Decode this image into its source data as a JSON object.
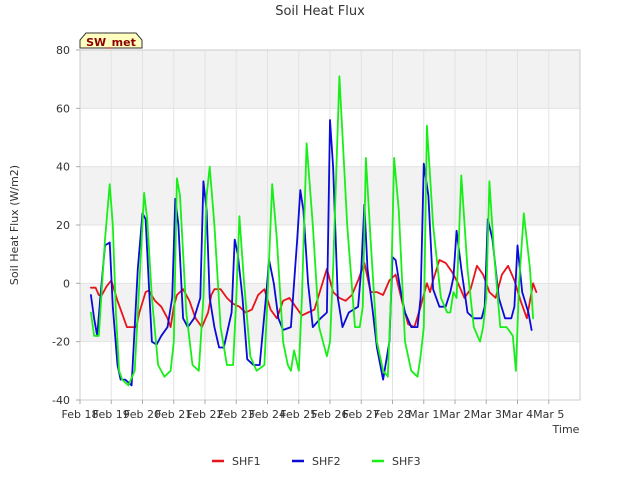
{
  "chart_data": {
    "type": "line",
    "title": "Soil Heat Flux",
    "xlabel": "Time",
    "ylabel": "Soil Heat Flux (W/m2)",
    "annotation": "SW_met",
    "ylim": [
      -40,
      80
    ],
    "yticks": [
      -40,
      -20,
      0,
      20,
      40,
      60,
      80
    ],
    "xlim": [
      0,
      16
    ],
    "xtick_labels": [
      "Feb 18",
      "Feb 19",
      "Feb 20",
      "Feb 21",
      "Feb 22",
      "Feb 23",
      "Feb 24",
      "Feb 25",
      "Feb 26",
      "Feb 27",
      "Feb 28",
      "Mar 1",
      "Mar 2",
      "Mar 3",
      "Mar 4",
      "Mar 5"
    ],
    "grid": true,
    "shaded_bands": [
      [
        -20,
        0
      ],
      [
        20,
        40
      ],
      [
        60,
        80
      ]
    ],
    "legend_position": "bottom-center",
    "series": [
      {
        "name": "SHF1",
        "color": "#e8141c",
        "x": [
          0.35,
          0.5,
          0.6,
          0.7,
          0.85,
          1.0,
          1.2,
          1.4,
          1.5,
          1.8,
          1.9,
          2.1,
          2.2,
          2.4,
          2.6,
          2.8,
          2.9,
          3.0,
          3.1,
          3.3,
          3.5,
          3.7,
          3.9,
          4.1,
          4.2,
          4.3,
          4.5,
          4.7,
          4.9,
          5.1,
          5.3,
          5.5,
          5.7,
          5.9,
          6.1,
          6.3,
          6.5,
          6.7,
          6.9,
          7.1,
          7.3,
          7.5,
          7.7,
          7.9,
          8.1,
          8.3,
          8.5,
          8.7,
          8.9,
          9.1,
          9.3,
          9.5,
          9.7,
          9.9,
          10.1,
          10.3,
          10.5,
          10.7,
          10.9,
          11.1,
          11.2,
          11.3,
          11.5,
          11.7,
          11.9,
          12.1,
          12.3,
          12.5,
          12.7,
          12.9,
          13.1,
          13.3,
          13.5,
          13.7,
          13.9,
          14.1,
          14.3,
          14.5,
          14.6
        ],
        "y": [
          -1.5,
          -1.5,
          -4,
          -4,
          -1,
          1,
          -6,
          -12,
          -15,
          -15,
          -10,
          -3,
          -2.5,
          -6,
          -8,
          -12,
          -15,
          -8,
          -4,
          -2,
          -6,
          -12,
          -15,
          -10,
          -4,
          -2,
          -2,
          -5,
          -7,
          -8,
          -10,
          -9,
          -4,
          -2,
          -9,
          -12,
          -6,
          -5,
          -8,
          -11,
          -10,
          -9,
          -2,
          5,
          -3,
          -5,
          -6,
          -4,
          1,
          7,
          -3,
          -3,
          -4,
          1,
          3,
          -6,
          -14,
          -15,
          -8,
          0,
          -3,
          1,
          8,
          7,
          4,
          0,
          -5,
          -2,
          6,
          3,
          -3,
          -5,
          3,
          6,
          1,
          -6,
          -12,
          0,
          -3
        ]
      },
      {
        "name": "SHF2",
        "color": "#0a0ad9",
        "x": [
          0.35,
          0.45,
          0.55,
          0.65,
          0.8,
          0.95,
          1.05,
          1.2,
          1.3,
          1.45,
          1.65,
          1.85,
          2.0,
          2.1,
          2.2,
          2.3,
          2.45,
          2.6,
          2.8,
          2.95,
          3.05,
          3.15,
          3.3,
          3.45,
          3.65,
          3.85,
          3.95,
          4.05,
          4.15,
          4.3,
          4.45,
          4.6,
          4.85,
          4.95,
          5.05,
          5.2,
          5.35,
          5.55,
          5.75,
          5.95,
          6.05,
          6.2,
          6.35,
          6.5,
          6.75,
          6.95,
          7.05,
          7.15,
          7.3,
          7.45,
          7.7,
          7.9,
          8.0,
          8.1,
          8.25,
          8.4,
          8.6,
          8.9,
          9.0,
          9.1,
          9.2,
          9.35,
          9.5,
          9.7,
          9.9,
          10.0,
          10.1,
          10.25,
          10.4,
          10.6,
          10.8,
          10.9,
          11.0,
          11.15,
          11.3,
          11.5,
          11.7,
          11.85,
          11.95,
          12.05,
          12.2,
          12.4,
          12.6,
          12.85,
          12.95,
          13.05,
          13.2,
          13.4,
          13.6,
          13.8,
          13.9,
          14.0,
          14.15,
          14.35,
          14.45
        ],
        "y": [
          -4,
          -12,
          -18,
          -5,
          13,
          14,
          -8,
          -28,
          -33,
          -33,
          -35,
          5,
          24,
          22,
          0,
          -20,
          -21,
          -18,
          -15,
          -5,
          29,
          20,
          -12,
          -15,
          -12,
          -5,
          35,
          25,
          -5,
          -15,
          -22,
          -22,
          -10,
          15,
          10,
          -5,
          -26,
          -28,
          -28,
          -5,
          8,
          0,
          -12,
          -16,
          -15,
          15,
          32,
          25,
          0,
          -15,
          -12,
          -10,
          56,
          40,
          -5,
          -15,
          -10,
          -8,
          5,
          27,
          5,
          -8,
          -22,
          -33,
          -20,
          9,
          8,
          -2,
          -10,
          -15,
          -15,
          -5,
          41,
          30,
          -2,
          -8,
          -8,
          -3,
          2,
          18,
          5,
          -10,
          -12,
          -12,
          -8,
          22,
          15,
          -5,
          -12,
          -12,
          -8,
          13,
          -3,
          -10,
          -16
        ]
      },
      {
        "name": "SHF3",
        "color": "#18ef18",
        "x": [
          0.35,
          0.45,
          0.6,
          0.8,
          0.95,
          1.05,
          1.15,
          1.25,
          1.35,
          1.55,
          1.75,
          1.95,
          2.05,
          2.15,
          2.3,
          2.5,
          2.7,
          2.9,
          3.0,
          3.1,
          3.2,
          3.4,
          3.6,
          3.8,
          3.95,
          4.05,
          4.15,
          4.3,
          4.5,
          4.7,
          4.9,
          5.0,
          5.1,
          5.25,
          5.45,
          5.65,
          5.9,
          6.0,
          6.15,
          6.3,
          6.5,
          6.65,
          6.75,
          6.85,
          7.0,
          7.1,
          7.25,
          7.45,
          7.65,
          7.9,
          8.0,
          8.1,
          8.3,
          8.55,
          8.8,
          8.95,
          9.05,
          9.15,
          9.3,
          9.5,
          9.7,
          9.85,
          9.95,
          10.05,
          10.2,
          10.4,
          10.6,
          10.8,
          10.9,
          11.0,
          11.1,
          11.3,
          11.55,
          11.75,
          11.85,
          11.95,
          12.05,
          12.2,
          12.4,
          12.6,
          12.8,
          12.9,
          13.0,
          13.1,
          13.25,
          13.45,
          13.65,
          13.85,
          13.95,
          14.05,
          14.2,
          14.4,
          14.5
        ],
        "y": [
          -10,
          -18,
          -18,
          15,
          34,
          20,
          -10,
          -30,
          -33,
          -35,
          -30,
          10,
          31,
          22,
          -5,
          -28,
          -32,
          -30,
          -20,
          36,
          30,
          -10,
          -28,
          -30,
          -5,
          30,
          40,
          20,
          -15,
          -28,
          -28,
          -5,
          23,
          0,
          -25,
          -30,
          -28,
          -5,
          34,
          15,
          -20,
          -28,
          -30,
          -23,
          -30,
          -5,
          48,
          20,
          -15,
          -25,
          -20,
          5,
          71,
          20,
          -15,
          -15,
          -8,
          43,
          15,
          -20,
          -30,
          -32,
          -5,
          43,
          25,
          -20,
          -30,
          -32,
          -25,
          -15,
          54,
          20,
          -5,
          -10,
          -10,
          -3,
          -5,
          37,
          5,
          -15,
          -20,
          -15,
          -5,
          35,
          10,
          -15,
          -15,
          -18,
          -30,
          0,
          24,
          5,
          -12
        ]
      }
    ]
  }
}
